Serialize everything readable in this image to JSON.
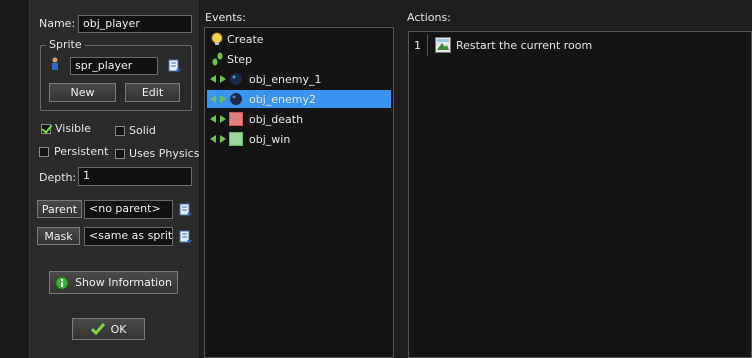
{
  "properties": {
    "name_label": "Name:",
    "name_value": "obj_player",
    "sprite_group_title": "Sprite",
    "sprite_value": "spr_player",
    "new_label": "New",
    "edit_label": "Edit",
    "visible_label": "Visible",
    "visible_checked": true,
    "solid_label": "Solid",
    "solid_checked": false,
    "persistent_label": "Persistent",
    "persistent_checked": false,
    "physics_label": "Uses Physics",
    "physics_checked": false,
    "depth_label": "Depth:",
    "depth_value": "1",
    "parent_label": "Parent",
    "parent_value": "<no parent>",
    "mask_label": "Mask",
    "mask_value": "<same as sprite>",
    "show_info_label": "Show Information",
    "ok_label": "OK"
  },
  "events": {
    "title": "Events:",
    "items": [
      {
        "label": "Create",
        "icon": "lightbulb-icon",
        "selected": false
      },
      {
        "label": "Step",
        "icon": "footsteps-icon",
        "selected": false
      },
      {
        "label": "obj_enemy_1",
        "icon": "collision-arrows-icon",
        "selected": false
      },
      {
        "label": "obj_enemy2",
        "icon": "collision-arrows-icon",
        "selected": true
      },
      {
        "label": "obj_death",
        "icon": "collision-arrows-icon",
        "selected": false
      },
      {
        "label": "obj_win",
        "icon": "collision-arrows-icon",
        "selected": false
      }
    ]
  },
  "actions": {
    "title": "Actions:",
    "items": [
      {
        "index": "1",
        "label": "Restart the current room",
        "icon": "restart-room-icon"
      }
    ]
  },
  "colors": {
    "selection": "#3a93f0",
    "panel": "#2b2b2b",
    "list_bg": "#141414",
    "checkmark": "#7fd640"
  }
}
